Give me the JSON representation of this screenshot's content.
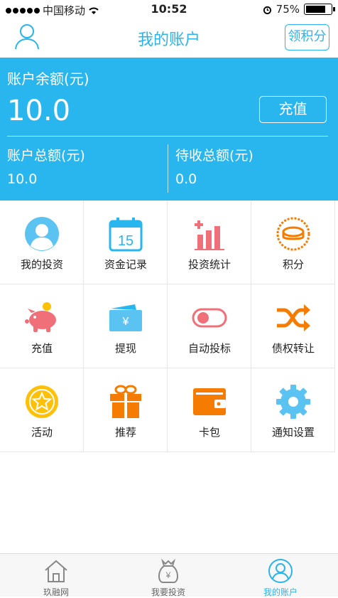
{
  "status_bar": {
    "carrier": "中国移动",
    "time": "10:52",
    "battery": "75%"
  },
  "nav": {
    "title": "我的账户",
    "right_button": "领积分"
  },
  "account": {
    "balance_label": "账户余额(元)",
    "balance_value": "10.0",
    "recharge_label": "充值",
    "total_label": "账户总额(元)",
    "total_value": "10.0",
    "pending_label": "待收总额(元)",
    "pending_value": "0.0"
  },
  "grid": [
    {
      "label": "我的投资",
      "icon": "avatar-icon"
    },
    {
      "label": "资金记录",
      "icon": "calendar-icon",
      "calendar_day": "15"
    },
    {
      "label": "投资统计",
      "icon": "bar-chart-icon"
    },
    {
      "label": "积分",
      "icon": "coin-icon"
    },
    {
      "label": "充值",
      "icon": "piggy-bank-icon"
    },
    {
      "label": "提现",
      "icon": "wallet-card-icon",
      "symbol": "¥"
    },
    {
      "label": "自动投标",
      "icon": "toggle-icon"
    },
    {
      "label": "债权转让",
      "icon": "shuffle-icon"
    },
    {
      "label": "活动",
      "icon": "star-badge-icon"
    },
    {
      "label": "推荐",
      "icon": "gift-icon"
    },
    {
      "label": "卡包",
      "icon": "card-wallet-icon"
    },
    {
      "label": "通知设置",
      "icon": "gear-icon"
    }
  ],
  "tabs": [
    {
      "label": "玖融网",
      "icon": "home-icon"
    },
    {
      "label": "我要投资",
      "icon": "money-bag-icon",
      "symbol": "¥"
    },
    {
      "label": "我的账户",
      "icon": "user-icon"
    }
  ],
  "colors": {
    "primary": "#29b6ee",
    "orange": "#f57c00",
    "pink": "#f0707a",
    "yellow": "#ffc107"
  }
}
